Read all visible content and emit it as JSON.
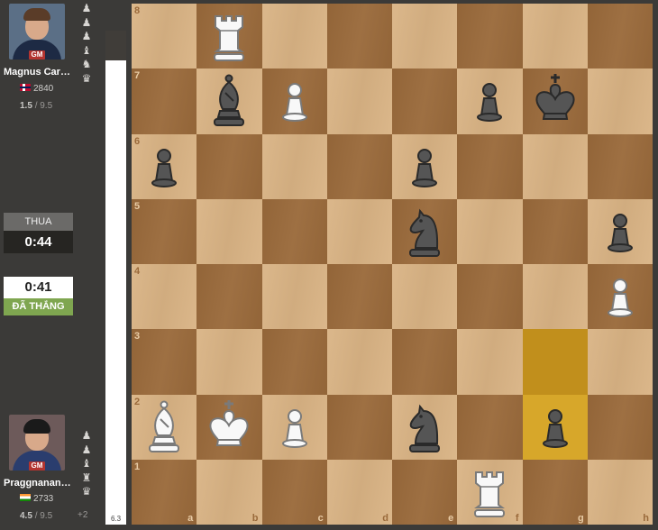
{
  "top_player": {
    "name": "Magnus Carls...",
    "title": "GM",
    "rating": "2840",
    "points": "1.5",
    "total": "/ 9.5",
    "captured": [
      "pawn",
      "pawn",
      "pawn",
      "bishop",
      "knight",
      "queen"
    ]
  },
  "bottom_player": {
    "name": "Praggnanand...",
    "title": "GM",
    "rating": "2733",
    "points": "4.5",
    "total": "/ 9.5",
    "captured": [
      "pawn",
      "pawn",
      "bishop",
      "rook",
      "queen"
    ],
    "advantage": "+2"
  },
  "clock_top": {
    "status": "THUA",
    "time": "0:44"
  },
  "clock_bottom": {
    "time": "0:41",
    "status": "ĐÃ THẮNG"
  },
  "eval": {
    "value": "6.3",
    "white_fraction": 0.94
  },
  "board": {
    "files": [
      "a",
      "b",
      "c",
      "d",
      "e",
      "f",
      "g",
      "h"
    ],
    "ranks": [
      "8",
      "7",
      "6",
      "5",
      "4",
      "3",
      "2",
      "1"
    ],
    "highlight_squares": [
      "g3",
      "g2"
    ],
    "pieces": [
      {
        "square": "b8",
        "color": "white",
        "type": "rook"
      },
      {
        "square": "b7",
        "color": "black",
        "type": "bishop"
      },
      {
        "square": "c7",
        "color": "white",
        "type": "pawn"
      },
      {
        "square": "f7",
        "color": "black",
        "type": "pawn"
      },
      {
        "square": "g7",
        "color": "black",
        "type": "king"
      },
      {
        "square": "a6",
        "color": "black",
        "type": "pawn"
      },
      {
        "square": "e6",
        "color": "black",
        "type": "pawn"
      },
      {
        "square": "e5",
        "color": "black",
        "type": "knight"
      },
      {
        "square": "h5",
        "color": "black",
        "type": "pawn"
      },
      {
        "square": "h4",
        "color": "white",
        "type": "pawn"
      },
      {
        "square": "a2",
        "color": "white",
        "type": "bishop"
      },
      {
        "square": "b2",
        "color": "white",
        "type": "king"
      },
      {
        "square": "c2",
        "color": "white",
        "type": "pawn"
      },
      {
        "square": "e2",
        "color": "black",
        "type": "knight"
      },
      {
        "square": "g2",
        "color": "black",
        "type": "pawn"
      },
      {
        "square": "f1",
        "color": "white",
        "type": "rook"
      }
    ]
  },
  "colors": {
    "light_square": "#d9b384",
    "dark_square": "#9a6a3b",
    "highlight": "#d7a72a",
    "win_green": "#7fa650",
    "title_red": "#b33430"
  }
}
